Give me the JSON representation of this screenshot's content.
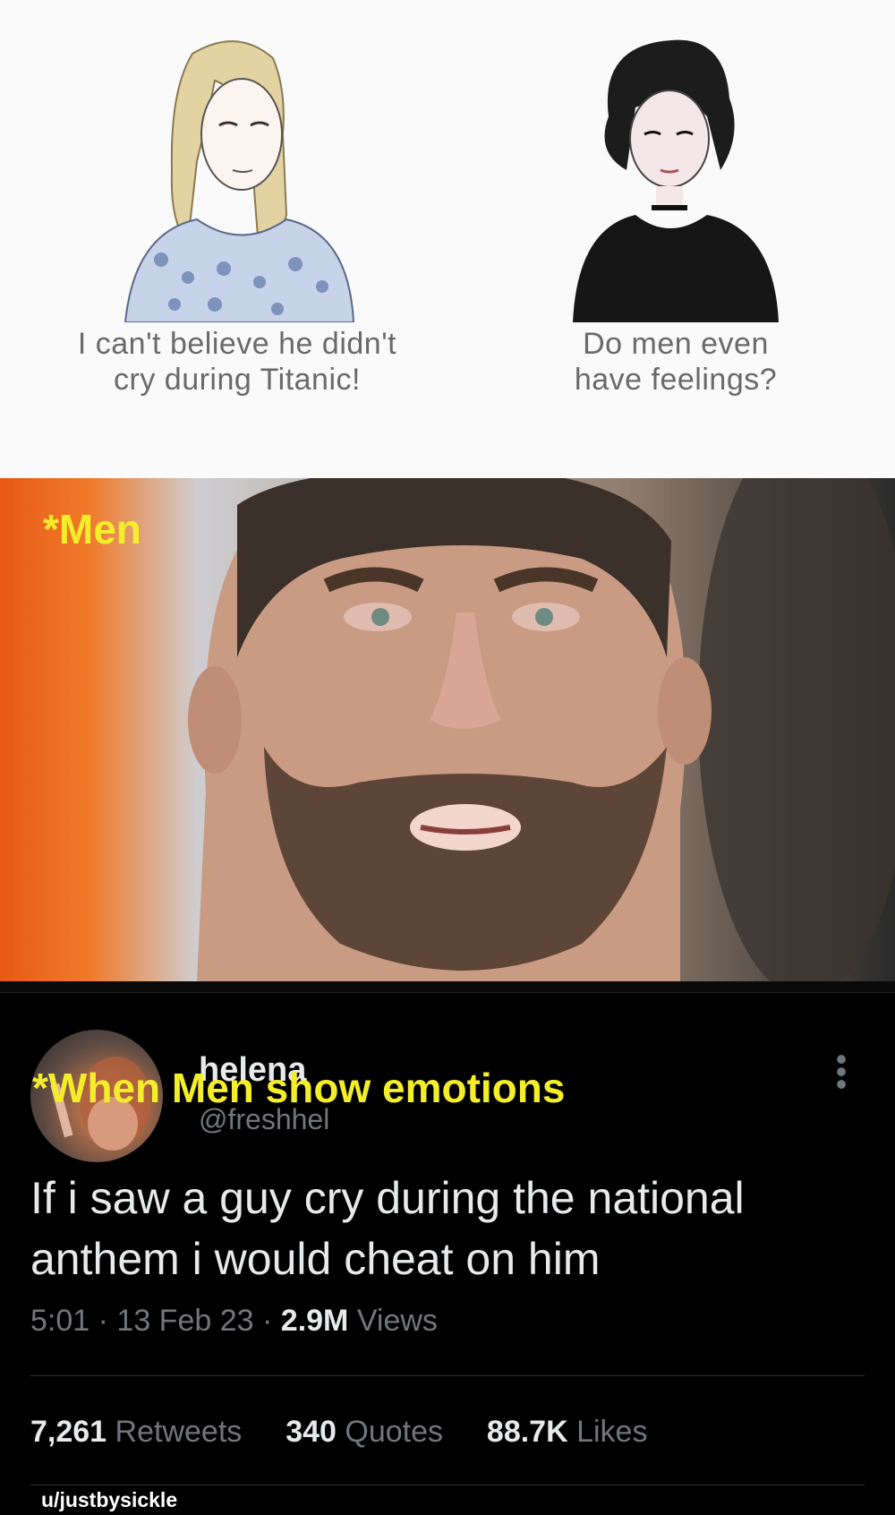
{
  "comic": {
    "left_caption_line1": "I can't believe he didn't",
    "left_caption_line2": "cry during Titanic!",
    "right_caption_line1": "Do men even",
    "right_caption_line2": "have feelings?"
  },
  "photo": {
    "label": "*Men"
  },
  "tweet": {
    "overlay_caption": "*When Men show emotions",
    "display_name": "helena",
    "handle": "@freshhel",
    "text": "If i saw a guy cry during the national anthem i would cheat on him",
    "time": "5:01",
    "date": "13 Feb 23",
    "views_count": "2.9M",
    "views_label": "Views",
    "retweets_count": "7,261",
    "retweets_label": "Retweets",
    "quotes_count": "340",
    "quotes_label": "Quotes",
    "likes_count": "88.7K",
    "likes_label": "Likes"
  },
  "credit": "u/justbysickle",
  "colors": {
    "caption_yellow": "#f4ee2a",
    "tweet_text": "#e7e9ea",
    "tweet_muted": "#71767b"
  }
}
